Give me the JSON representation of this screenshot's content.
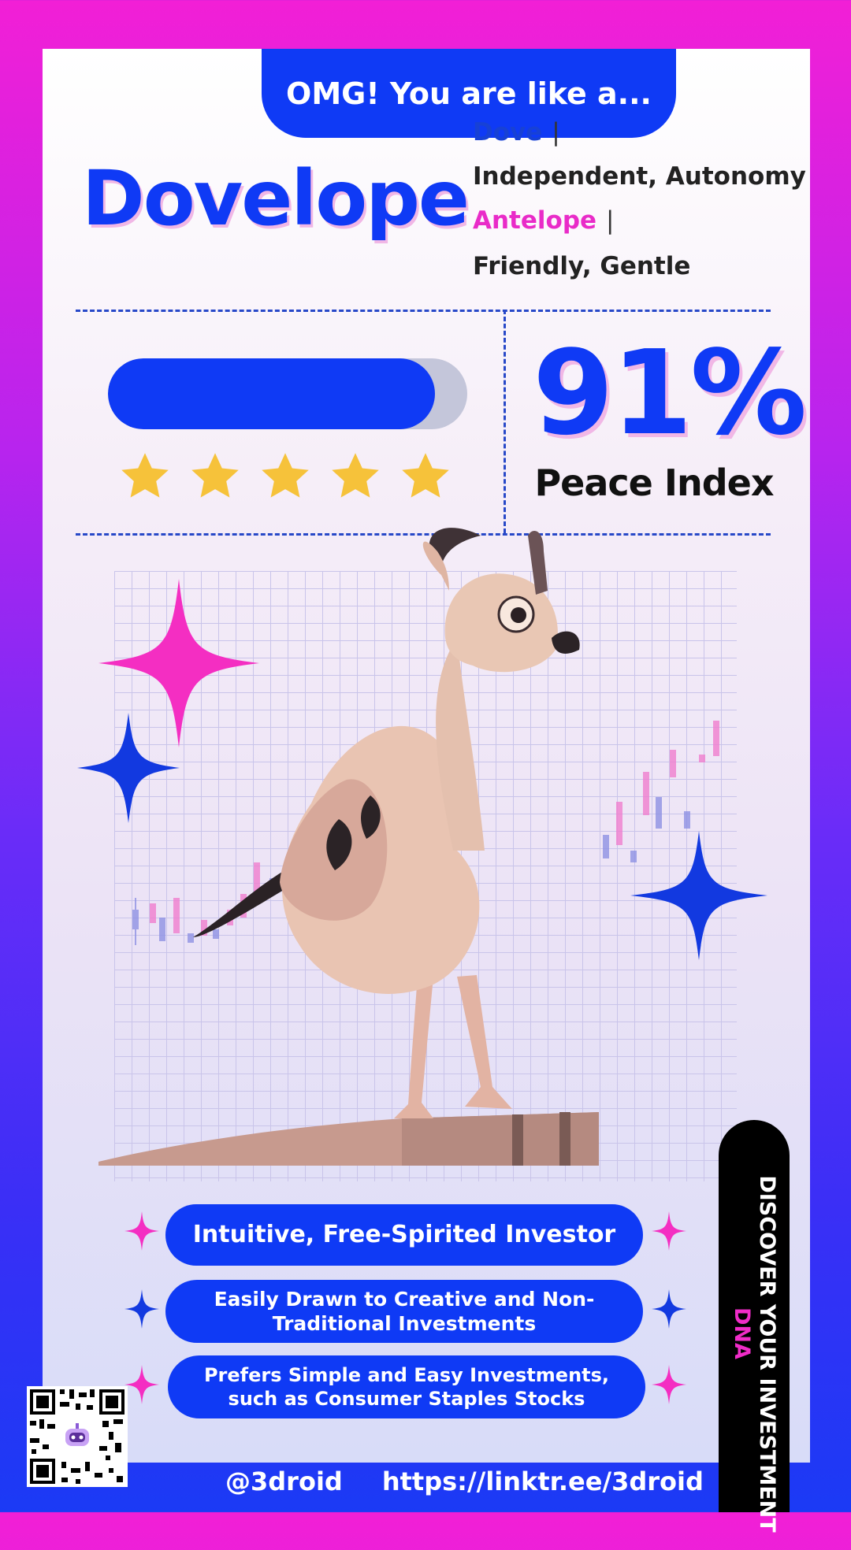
{
  "header": {
    "tab_label": "OMG! You are like a..."
  },
  "result": {
    "name": "Dovelope",
    "animals": [
      {
        "name": "Dove",
        "traits": "Independent, Autonomy"
      },
      {
        "name": "Antelope",
        "traits": "Friendly, Gentle"
      }
    ]
  },
  "index": {
    "percent_label": "91%",
    "label": "Peace Index",
    "bar_fill_fraction": 0.91,
    "stars": 5
  },
  "traits_list": [
    "Intuitive, Free-Spirited Investor",
    "Easily Drawn to Creative and Non-Traditional Investments",
    "Prefers Simple and Easy Investments, such as Consumer Staples Stocks"
  ],
  "side_banner": {
    "line1": "DISCOVER YOUR INVESTMENT",
    "line2": "DNA"
  },
  "footer": {
    "handle": "@3droid",
    "link": "https://linktr.ee/3droid"
  },
  "colors": {
    "primary": "#0f3af5",
    "accent": "#f02cc8",
    "star": "#f6c23a"
  },
  "icons": [
    "star-icon",
    "sparkle-icon",
    "qr-code",
    "robot-icon"
  ]
}
